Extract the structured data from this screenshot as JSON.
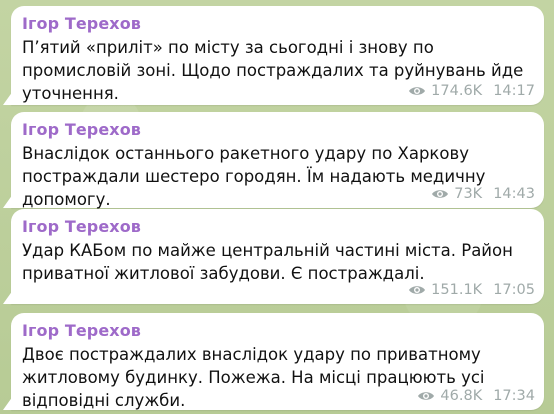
{
  "messages": [
    {
      "author": "Ігор Терехов",
      "text": "П’ятий «приліт» по місту за сьогодні і знову по промисловій зоні. Щодо постраждалих та руйнувань йде уточнення.",
      "views": "174.6K",
      "time": "14:17"
    },
    {
      "author": "Ігор Терехов",
      "text": "Внаслідок останнього ракетного удару по Харкову постраждали шестеро городян. Їм надають медичну допомогу.",
      "views": "73K",
      "time": "14:43"
    },
    {
      "author": "Ігор Терехов",
      "text": "Удар КАБом по майже центральній частині міста. Район приватної житлової забудови. Є постраждалі.",
      "views": "151.1K",
      "time": "17:05"
    },
    {
      "author": "Ігор Терехов",
      "text": "Двоє постраждалих внаслідок удару по приватному житловому будинку. Пожежа. На місці працюють усі відповідні служби.",
      "views": "46.8K",
      "time": "17:34"
    }
  ],
  "icons": {
    "views": "eye-icon"
  },
  "colors": {
    "author": "#9e6ac9",
    "meta": "#a0aaa9",
    "background": "#bccf9c",
    "bubble": "#ffffff"
  }
}
